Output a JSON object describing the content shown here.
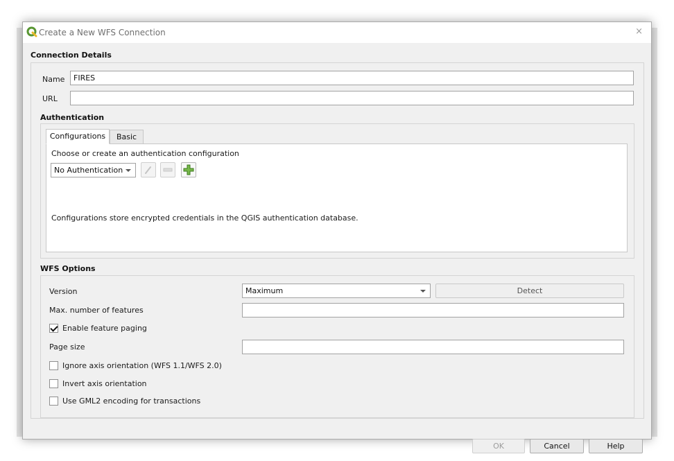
{
  "window": {
    "title": "Create a New WFS Connection",
    "close_glyph": "×",
    "app_icon": "qgis-logo-icon"
  },
  "connection": {
    "section_title": "Connection Details",
    "name_label": "Name",
    "name_value": "FIRES",
    "url_label": "URL",
    "url_value": ""
  },
  "authentication": {
    "section_title": "Authentication",
    "tabs": [
      {
        "label": "Configurations",
        "active": true
      },
      {
        "label": "Basic",
        "active": false
      }
    ],
    "choose_label": "Choose or create an authentication configuration",
    "selected_config": "No Authentication",
    "edit_icon": "pencil-edit-icon",
    "remove_icon": "remove-icon",
    "add_icon": "add-green-icon",
    "info_text": "Configurations store encrypted credentials in the QGIS authentication database."
  },
  "wfs_options": {
    "section_title": "WFS Options",
    "version_label": "Version",
    "version_value": "Maximum",
    "detect_label": "Detect",
    "max_features_label": "Max. number of features",
    "max_features_value": "",
    "paging_label": "Enable feature paging",
    "paging_checked": true,
    "page_size_label": "Page size",
    "page_size_value": "",
    "ignore_axis_label": "Ignore axis orientation (WFS 1.1/WFS 2.0)",
    "ignore_axis_checked": false,
    "invert_axis_label": "Invert axis orientation",
    "invert_axis_checked": false,
    "gml2_label": "Use GML2 encoding for transactions",
    "gml2_checked": false
  },
  "buttons": {
    "ok": "OK",
    "cancel": "Cancel",
    "help": "Help"
  },
  "colors": {
    "dialog_bg": "#f0f0f0",
    "accent_green": "#589632",
    "text": "#1a1a1a"
  }
}
